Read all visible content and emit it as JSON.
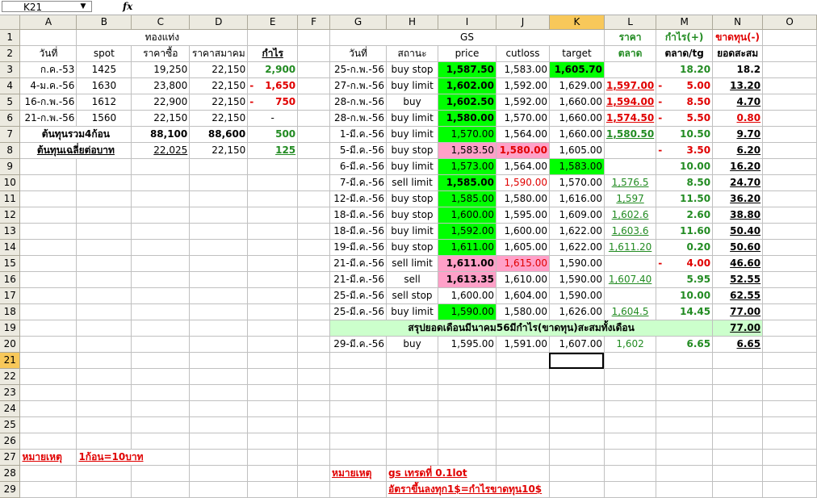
{
  "formula_bar": {
    "name_box": "K21",
    "fx_label": "fx",
    "formula": ""
  },
  "col_headers": [
    "A",
    "B",
    "C",
    "D",
    "E",
    "F",
    "G",
    "H",
    "I",
    "J",
    "K",
    "L",
    "M",
    "N",
    "O"
  ],
  "row_headers": [
    "1",
    "2",
    "3",
    "4",
    "5",
    "6",
    "7",
    "8",
    "9",
    "10",
    "11",
    "12",
    "13",
    "14",
    "15",
    "16",
    "17",
    "18",
    "19",
    "20",
    "21",
    "22",
    "23",
    "24",
    "25",
    "26",
    "27",
    "28",
    "29"
  ],
  "left": {
    "title": "ทองแท่ง",
    "headers": [
      "วันที่",
      "spot",
      "ราคาซื้อ",
      "ราคาสมาคม",
      "กำไร"
    ],
    "rows": [
      {
        "date": "ก.ค.-53",
        "spot": "1425",
        "buy": "19,250",
        "assoc": "22,150",
        "sign": "",
        "profit": "2,900"
      },
      {
        "date": "4-ม.ค.-56",
        "spot": "1630",
        "buy": "23,800",
        "assoc": "22,150",
        "sign": "-",
        "profit": "1,650"
      },
      {
        "date": "16-ก.พ.-56",
        "spot": "1612",
        "buy": "22,900",
        "assoc": "22,150",
        "sign": "-",
        "profit": "750"
      },
      {
        "date": "21-ก.พ.-56",
        "spot": "1560",
        "buy": "22,150",
        "assoc": "22,150",
        "sign": "",
        "profit": "-"
      }
    ],
    "total_label": "ต้นทุนรวม4ก้อน",
    "total_buy": "88,100",
    "total_assoc": "88,600",
    "total_profit": "500",
    "avg_label": "ต้นทุนเฉลี่ยต่อบาท",
    "avg_buy": "22,025",
    "avg_assoc": "22,150",
    "avg_profit": "125",
    "note_label": "หมายเหตุ",
    "note_text": "1ก้อน=10บาท"
  },
  "gs": {
    "title": "GS",
    "headers": [
      "วันที่",
      "สถานะ",
      "price",
      "cutloss",
      "target"
    ],
    "l_header1": "ราคา",
    "l_header2": "ตลาด",
    "m_header1": "กำไร(+)",
    "m_header2": "ตลาด/tg",
    "n_header1": "ขาดทุน(-)",
    "n_header2": "ยอดสะสม",
    "rows": [
      {
        "date": "25-ก.พ.-56",
        "status": "buy stop",
        "price": "1,587.50",
        "cut": "1,583.00",
        "target": "1,605.70",
        "market": "",
        "msign": "",
        "m": "18.20",
        "n": "18.2"
      },
      {
        "date": "27-ก.พ.-56",
        "status": "buy limit",
        "price": "1,602.00",
        "cut": "1,592.00",
        "target": "1,629.00",
        "market": "1,597.00",
        "msign": "-",
        "m": "5.00",
        "n": "13.20"
      },
      {
        "date": "28-ก.พ.-56",
        "status": "buy",
        "price": "1,602.50",
        "cut": "1,592.00",
        "target": "1,660.00",
        "market": "1,594.00",
        "msign": "-",
        "m": "8.50",
        "n": "4.70"
      },
      {
        "date": "28-ก.พ.-56",
        "status": "buy limit",
        "price": "1,580.00",
        "cut": "1,570.00",
        "target": "1,660.00",
        "market": "1,574.50",
        "msign": "-",
        "m": "5.50",
        "n": "0.80"
      },
      {
        "date": "1-มี.ค.-56",
        "status": "buy limit",
        "price": "1,570.00",
        "cut": "1,564.00",
        "target": "1,660.00",
        "market": "1,580.50",
        "msign": "",
        "m": "10.50",
        "n": "9.70"
      },
      {
        "date": "5-มี.ค.-56",
        "status": "buy stop",
        "price": "1,583.50",
        "cut": "1,580.00",
        "target": "1,605.00",
        "market": "",
        "msign": "-",
        "m": "3.50",
        "n": "6.20"
      },
      {
        "date": "6-มี.ค.-56",
        "status": "buy limit",
        "price": "1,573.00",
        "cut": "1,564.00",
        "target": "1,583.00",
        "market": "",
        "msign": "",
        "m": "10.00",
        "n": "16.20"
      },
      {
        "date": "7-มี.ค.-56",
        "status": "sell limit",
        "price": "1,585.00",
        "cut": "1,590.00",
        "target": "1,570.00",
        "market": "1,576.5",
        "msign": "",
        "m": "8.50",
        "n": "24.70"
      },
      {
        "date": "12-มี.ค.-56",
        "status": "buy stop",
        "price": "1,585.00",
        "cut": "1,580.00",
        "target": "1,616.00",
        "market": "1,597",
        "msign": "",
        "m": "11.50",
        "n": "36.20"
      },
      {
        "date": "18-มี.ค.-56",
        "status": "buy stop",
        "price": "1,600.00",
        "cut": "1,595.00",
        "target": "1,609.00",
        "market": "1,602.6",
        "msign": "",
        "m": "2.60",
        "n": "38.80"
      },
      {
        "date": "18-มี.ค.-56",
        "status": "buy limit",
        "price": "1,592.00",
        "cut": "1,600.00",
        "target": "1,622.00",
        "market": "1,603.6",
        "msign": "",
        "m": "11.60",
        "n": "50.40"
      },
      {
        "date": "19-มี.ค.-56",
        "status": "buy stop",
        "price": "1,611.00",
        "cut": "1,605.00",
        "target": "1,622.00",
        "market": "1,611.20",
        "msign": "",
        "m": "0.20",
        "n": "50.60"
      },
      {
        "date": "21-มี.ค.-56",
        "status": "sell limit",
        "price": "1,611.00",
        "cut": "1,615.00",
        "target": "1,590.00",
        "market": "",
        "msign": "-",
        "m": "4.00",
        "n": "46.60"
      },
      {
        "date": "21-มี.ค.-56",
        "status": "sell",
        "price": "1,613.35",
        "cut": "1,610.00",
        "target": "1,590.00",
        "market": "1,607.40",
        "msign": "",
        "m": "5.95",
        "n": "52.55"
      },
      {
        "date": "25-มี.ค.-56",
        "status": "sell stop",
        "price": "1,600.00",
        "cut": "1,604.00",
        "target": "1,590.00",
        "market": "",
        "msign": "",
        "m": "10.00",
        "n": "62.55"
      },
      {
        "date": "25-มี.ค.-56",
        "status": "buy limit",
        "price": "1,590.00",
        "cut": "1,580.00",
        "target": "1,626.00",
        "market": "1,604.5",
        "msign": "",
        "m": "14.45",
        "n": "77.00"
      }
    ],
    "summary_label": "สรุปยอดเดือนมีนาคม56มีกำไร(ขาดทุน)สะสมทั้งเดือน",
    "summary_value": "77.00",
    "row20": {
      "date": "29-มี.ค.-56",
      "status": "buy",
      "price": "1,595.00",
      "cut": "1,591.00",
      "target": "1,607.00",
      "market": "1,602",
      "m": "6.65",
      "n": "6.65"
    },
    "note_label": "หมายเหตุ",
    "note_text1": "gs เทรดที่ 0.1lot",
    "note_text2": "อัตราขึ้นลงทุก1$=กำไรขาดทุน10$"
  }
}
